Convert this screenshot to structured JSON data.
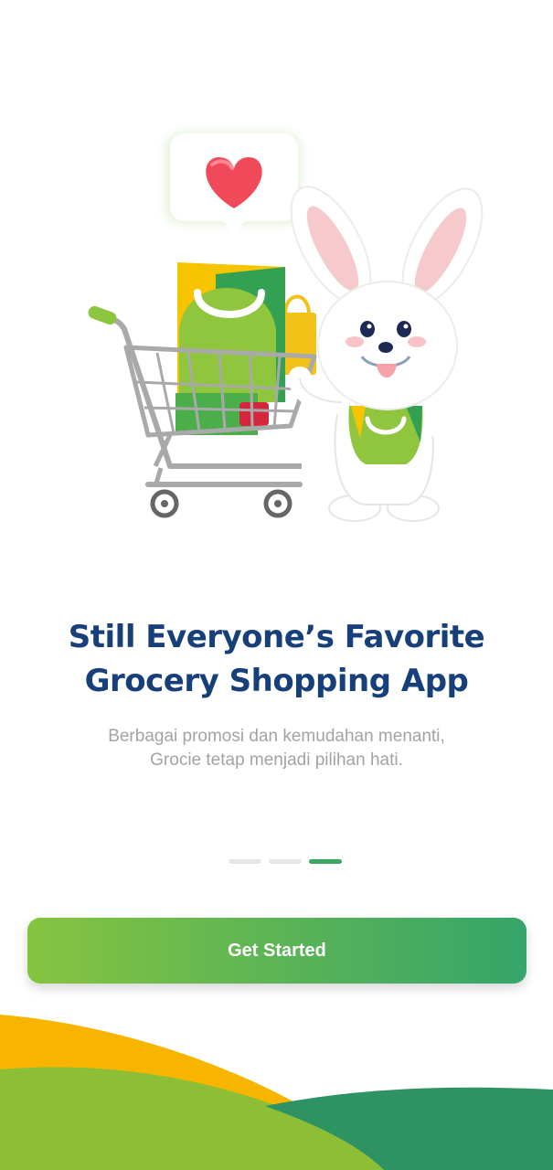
{
  "onboarding": {
    "title_line1": "Still Everyone’s Favorite",
    "title_line2": "Grocery Shopping App",
    "subtitle_line1": "Berbagai promosi dan kemudahan menanti,",
    "subtitle_line2": "Grocie tetap menjadi pilihan hati.",
    "page_indicator": {
      "total": 3,
      "current": 3
    },
    "cta_label": "Get Started"
  },
  "colors": {
    "title": "#17407a",
    "accent_green": "#3aa860",
    "accent_yellow": "#f7b500",
    "dark_green": "#2e9060"
  },
  "icons": [
    "heart-icon",
    "shopping-cart-icon",
    "bunny-mascot"
  ]
}
